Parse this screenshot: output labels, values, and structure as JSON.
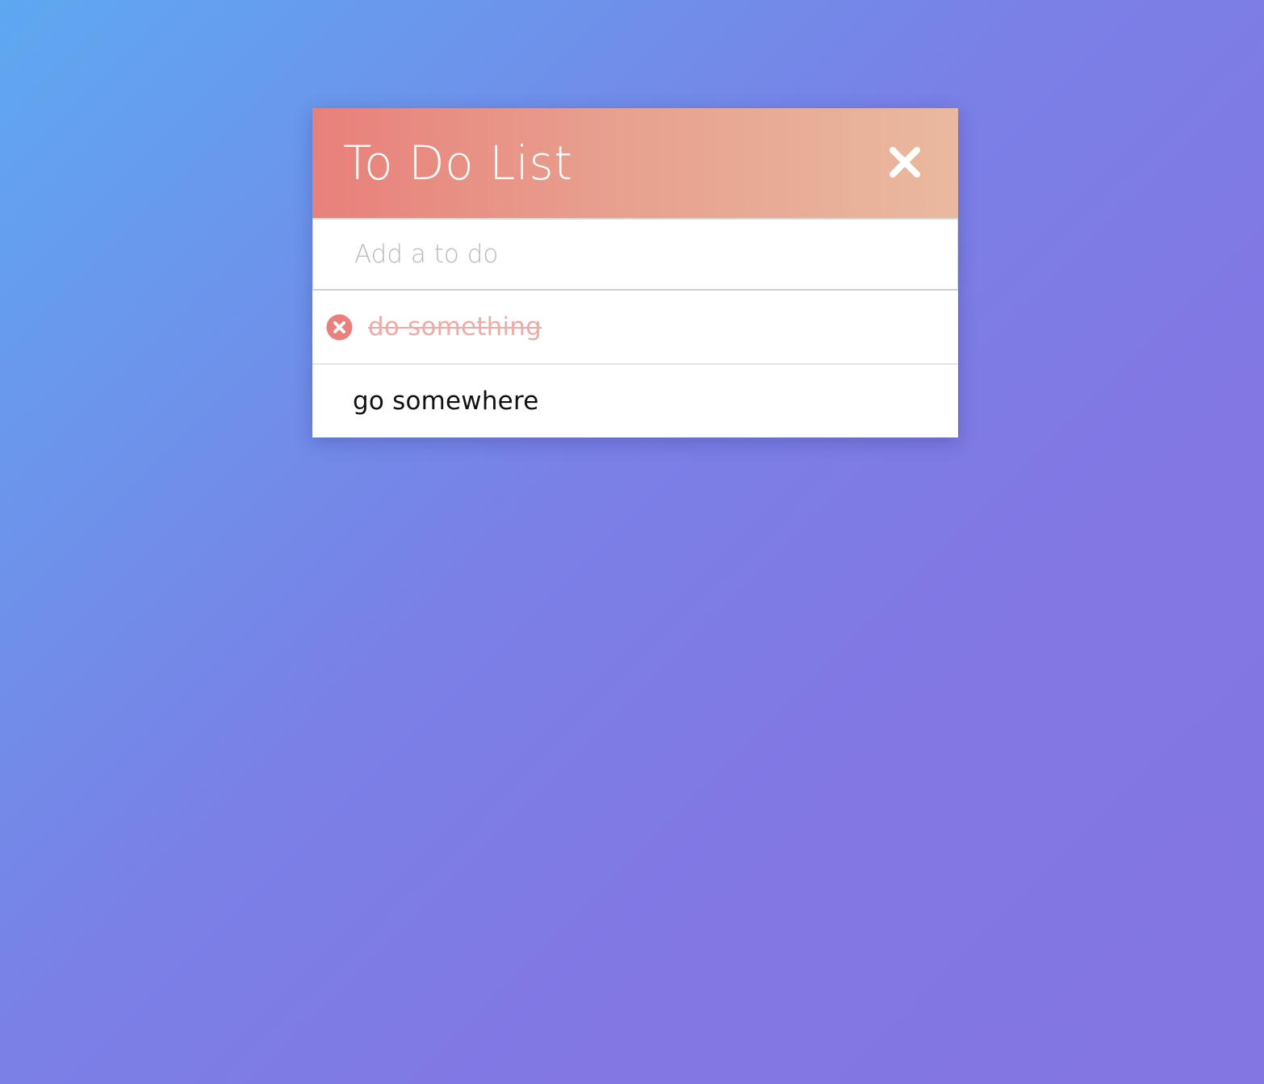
{
  "app": {
    "title": "To Do List"
  },
  "input": {
    "placeholder": "Add a to do",
    "value": ""
  },
  "todos": [
    {
      "text": "do something",
      "completed": true
    },
    {
      "text": "go somewhere",
      "completed": false
    }
  ],
  "icons": {
    "header_close": "close-icon",
    "item_delete": "delete-circle-icon"
  },
  "colors": {
    "background_start": "#5ea8f0",
    "background_end": "#8376e2",
    "header_start": "#e8807a",
    "header_end": "#e9b99e",
    "completed_text": "#f2aaa6",
    "delete_icon": "#ea7f7c"
  }
}
